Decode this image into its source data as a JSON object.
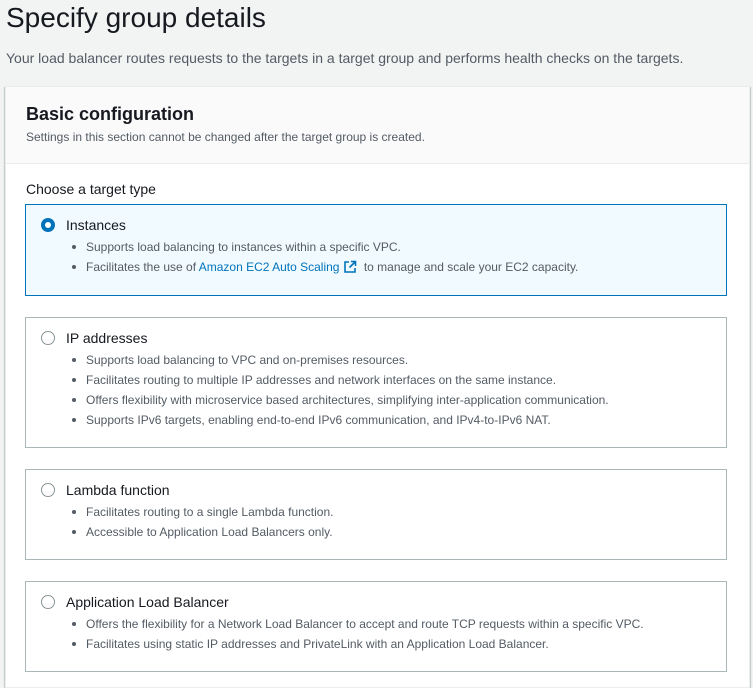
{
  "page": {
    "title": "Specify group details",
    "description": "Your load balancer routes requests to the targets in a target group and performs health checks on the targets."
  },
  "basic_configuration": {
    "title": "Basic configuration",
    "description": "Settings in this section cannot be changed after the target group is created.",
    "target_type_label": "Choose a target type",
    "selected": "instances",
    "options": [
      {
        "id": "instances",
        "label": "Instances",
        "bullets": [
          "Supports load balancing to instances within a specific VPC."
        ],
        "bullet_with_link": {
          "before": "Facilitates the use of ",
          "link": "Amazon EC2 Auto Scaling",
          "after": " to manage and scale your EC2 capacity."
        }
      },
      {
        "id": "ip",
        "label": "IP addresses",
        "bullets": [
          "Supports load balancing to VPC and on-premises resources.",
          "Facilitates routing to multiple IP addresses and network interfaces on the same instance.",
          "Offers flexibility with microservice based architectures, simplifying inter-application communication.",
          "Supports IPv6 targets, enabling end-to-end IPv6 communication, and IPv4-to-IPv6 NAT."
        ]
      },
      {
        "id": "lambda",
        "label": "Lambda function",
        "bullets": [
          "Facilitates routing to a single Lambda function.",
          "Accessible to Application Load Balancers only."
        ]
      },
      {
        "id": "alb",
        "label": "Application Load Balancer",
        "bullets": [
          "Offers the flexibility for a Network Load Balancer to accept and route TCP requests within a specific VPC.",
          "Facilitates using static IP addresses and PrivateLink with an Application Load Balancer."
        ]
      }
    ]
  },
  "colors": {
    "accent": "#0073bb",
    "selected_bg": "#f1faff",
    "border": "#aab7b8",
    "text": "#16191f",
    "secondary_text": "#545b64"
  }
}
